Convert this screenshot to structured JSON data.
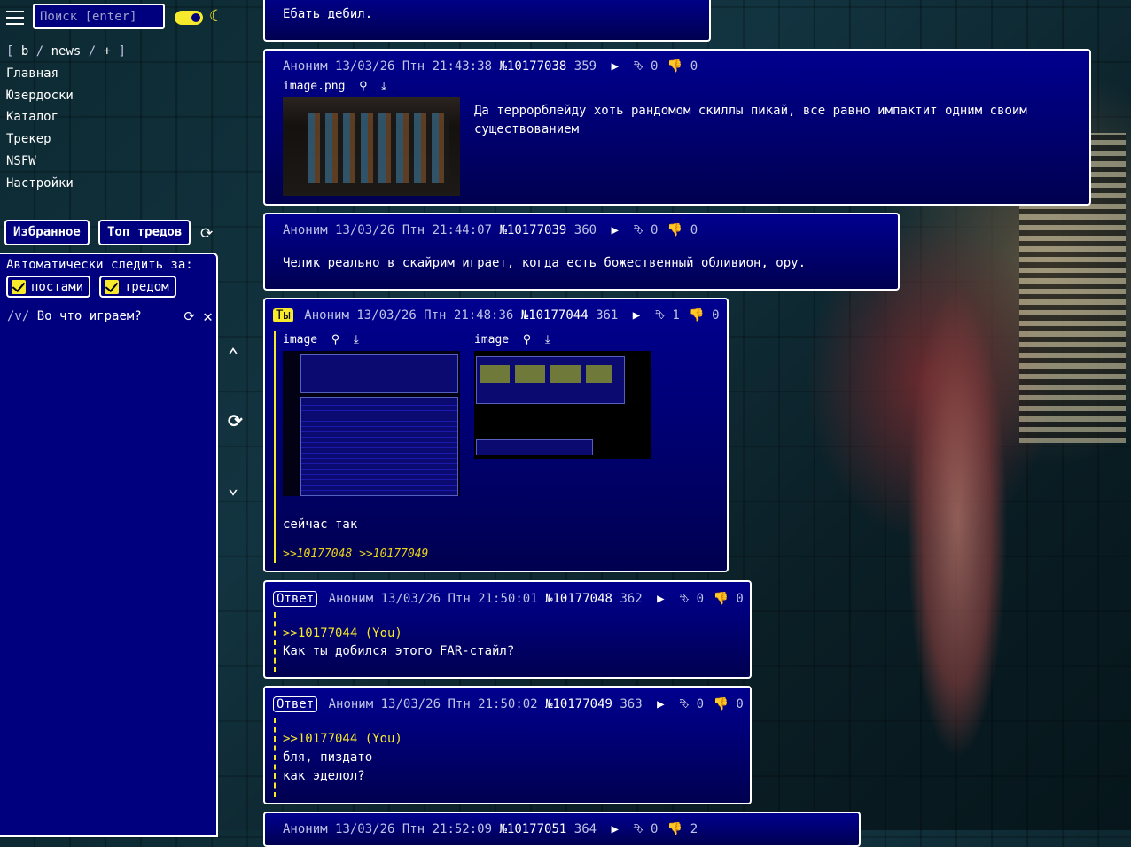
{
  "sidebar": {
    "search_placeholder": "Поиск [enter]",
    "board_line": [
      "[",
      "b",
      "/",
      "news",
      "/",
      "+",
      "]"
    ],
    "nav": [
      "Главная",
      "Юзердоски",
      "Каталог",
      "Трекер",
      "NSFW",
      "Настройки"
    ],
    "tabs": {
      "favorites": "Избранное",
      "top_threads": "Топ тредов"
    },
    "autowatch_label": "Автоматически следить за:",
    "chk_posts": "постами",
    "chk_thread": "тредом",
    "watched_board": "/v/",
    "watched_title": "Во что играем?"
  },
  "icons": {
    "accent": "#f7ea2c",
    "panel": "#00007e"
  },
  "posts": [
    {
      "text": "Ебать дебил."
    },
    {
      "author": "Аноним",
      "date": "13/03/26 Птн 21:43:38",
      "num": "№10177038",
      "idx": "359",
      "likes": "0",
      "dislikes": "0",
      "file": "image.png",
      "text": "Да террорблейду хоть рандомом скиллы пикай, все равно импактит одним своим существованием"
    },
    {
      "author": "Аноним",
      "date": "13/03/26 Птн 21:44:07",
      "num": "№10177039",
      "idx": "360",
      "likes": "0",
      "dislikes": "0",
      "text": "Челик реально в скайрим играет, когда есть божественный обливион, ору."
    },
    {
      "badge": "Ты",
      "author": "Аноним",
      "date": "13/03/26 Птн 21:48:36",
      "num": "№10177044",
      "idx": "361",
      "likes": "1",
      "dislikes": "0",
      "file1": "image",
      "file2": "image",
      "text": "сейчас так",
      "replies": ">>10177048 >>10177049"
    },
    {
      "badge": "Ответ",
      "author": "Аноним",
      "date": "13/03/26 Птн 21:50:01",
      "num": "№10177048",
      "idx": "362",
      "likes": "0",
      "dislikes": "0",
      "quote": ">>10177044 (You)",
      "text": "Как ты добился этого FAR-стайл?"
    },
    {
      "badge": "Ответ",
      "author": "Аноним",
      "date": "13/03/26 Птн 21:50:02",
      "num": "№10177049",
      "idx": "363",
      "likes": "0",
      "dislikes": "0",
      "quote": ">>10177044 (You)",
      "text1": "бля, пиздато",
      "text2": "как эделол?"
    },
    {
      "author": "Аноним",
      "date": "13/03/26 Птн 21:52:09",
      "num": "№10177051",
      "idx": "364",
      "likes": "0",
      "dislikes": "2"
    }
  ]
}
